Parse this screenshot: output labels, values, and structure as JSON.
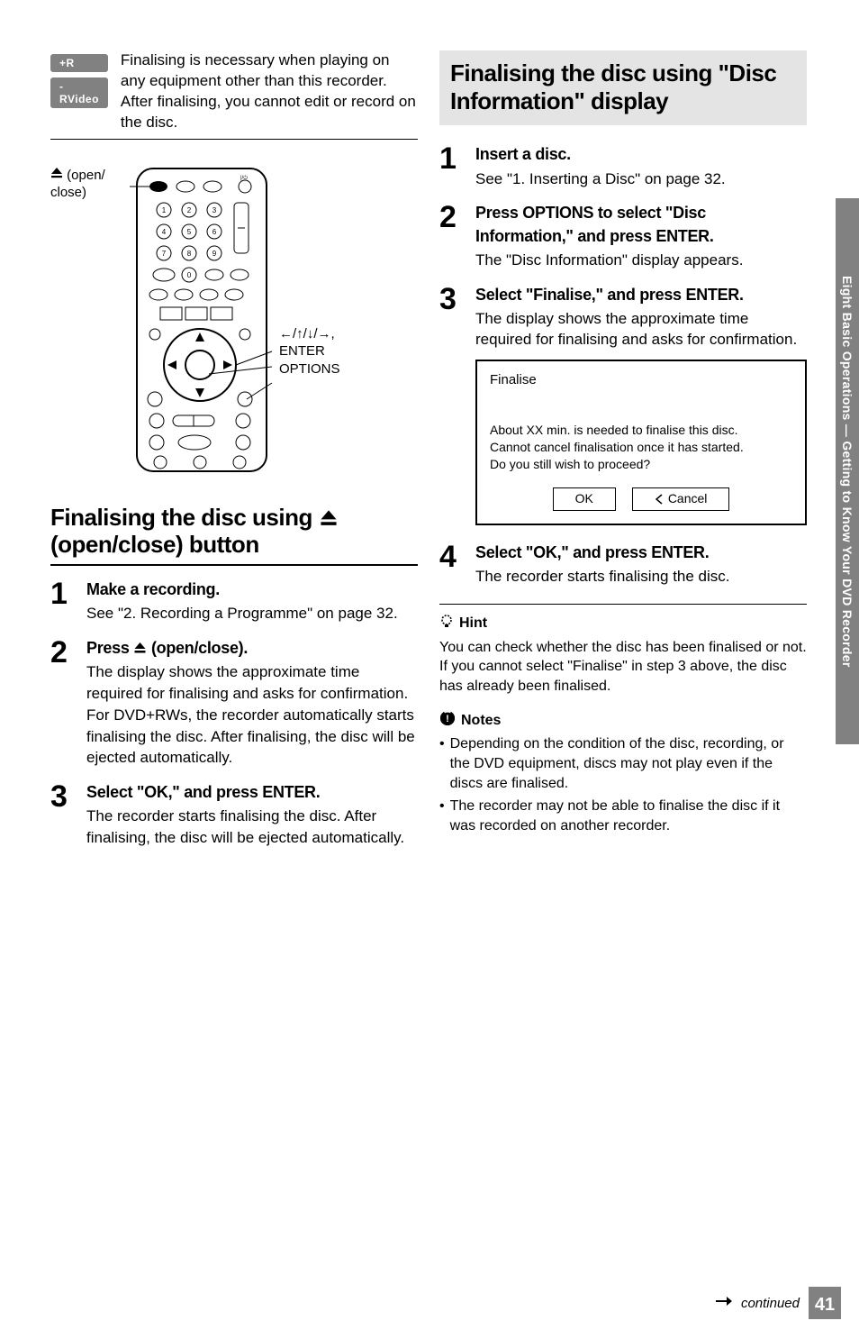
{
  "intro": {
    "badge_r": "+R",
    "badge_rvideo": "-RVideo",
    "text_line1": "Finalising is necessary when playing on any equipment other than this recorder.",
    "text_line2": "After finalising, you cannot edit or record on the disc."
  },
  "remote": {
    "eject_label_prefix": "(open/",
    "eject_label_suffix": "close)",
    "annotation_arrows": "←/↑/↓/→,",
    "annotation_enter": "ENTER",
    "annotation_options": "OPTIONS"
  },
  "section_left": {
    "heading_prefix": "Finalising the disc using ",
    "heading_suffix": " (open/close) button",
    "steps": [
      {
        "title": "Make a recording.",
        "body": "See \"2. Recording a Programme\" on page 32."
      },
      {
        "title_prefix": "Press ",
        "title_suffix": " (open/close).",
        "body": "The display shows the approximate time required for finalising and asks for confirmation.\nFor DVD+RWs, the recorder automatically starts finalising the disc. After finalising, the disc will be ejected automatically."
      },
      {
        "title": "Select \"OK,\" and press ENTER.",
        "body": "The recorder starts finalising the disc. After finalising, the disc will be ejected automatically."
      }
    ]
  },
  "section_right": {
    "heading": "Finalising the disc using \"Disc Information\" display",
    "steps": [
      {
        "title": "Insert a disc.",
        "body": "See \"1. Inserting a Disc\" on page 32."
      },
      {
        "title": "Press OPTIONS to select \"Disc Information,\" and press ENTER.",
        "body": "The \"Disc Information\" display appears."
      },
      {
        "title": "Select \"Finalise,\" and press ENTER.",
        "body": "The display shows the approximate time required for finalising and asks for confirmation."
      },
      {
        "title": "Select \"OK,\" and press ENTER.",
        "body": "The recorder starts finalising the disc."
      }
    ]
  },
  "dialog": {
    "title": "Finalise",
    "msg_line1": "About XX min. is needed to finalise this disc.",
    "msg_line2": "Cannot cancel finalisation once it has started.",
    "msg_line3": "Do you still wish to proceed?",
    "btn_ok": "OK",
    "btn_cancel": "Cancel"
  },
  "hint": {
    "label": "Hint",
    "text": "You can check whether the disc has been finalised or not. If you cannot select \"Finalise\" in step 3 above, the disc has already been finalised."
  },
  "notes": {
    "label": "Notes",
    "items": [
      "Depending on the condition of the disc, recording, or the DVD equipment, discs may not play even if the discs are finalised.",
      "The recorder may not be able to finalise the disc if it was recorded on another recorder."
    ]
  },
  "side_tab": "Eight Basic Operations — Getting to Know Your DVD Recorder",
  "footer": {
    "continued": "continued",
    "page": "41"
  },
  "step_nums": [
    "1",
    "2",
    "3",
    "4"
  ]
}
